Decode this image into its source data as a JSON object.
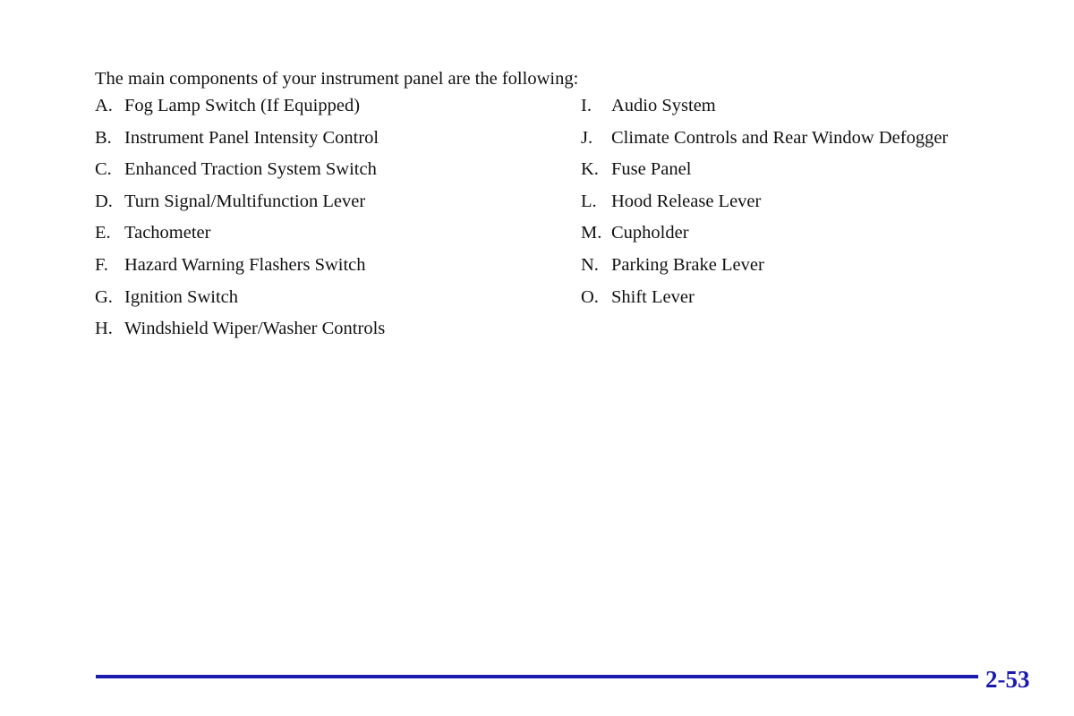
{
  "document": {
    "intro_text": "The main components of your instrument panel are the following:",
    "columns": {
      "left": [
        {
          "letter": "A.",
          "label": "Fog Lamp Switch (If Equipped)"
        },
        {
          "letter": "B.",
          "label": "Instrument Panel Intensity Control"
        },
        {
          "letter": "C.",
          "label": "Enhanced Traction System Switch"
        },
        {
          "letter": "D.",
          "label": "Turn Signal/Multifunction Lever"
        },
        {
          "letter": "E.",
          "label": "Tachometer"
        },
        {
          "letter": "F.",
          "label": "Hazard Warning Flashers Switch"
        },
        {
          "letter": "G.",
          "label": "Ignition Switch"
        },
        {
          "letter": "H.",
          "label": "Windshield Wiper/Washer Controls"
        }
      ],
      "right": [
        {
          "letter": "I.",
          "label": "Audio System"
        },
        {
          "letter": "J.",
          "label": "Climate Controls and Rear Window Defogger"
        },
        {
          "letter": "K.",
          "label": "Fuse Panel"
        },
        {
          "letter": "L.",
          "label": "Hood Release Lever"
        },
        {
          "letter": "M.",
          "label": "Cupholder"
        },
        {
          "letter": "N.",
          "label": "Parking Brake Lever"
        },
        {
          "letter": "O.",
          "label": "Shift Lever"
        }
      ]
    }
  },
  "footer": {
    "page_number": "2-53",
    "rule_color": "#1a1aad",
    "page_number_color": "#1a1aad"
  }
}
